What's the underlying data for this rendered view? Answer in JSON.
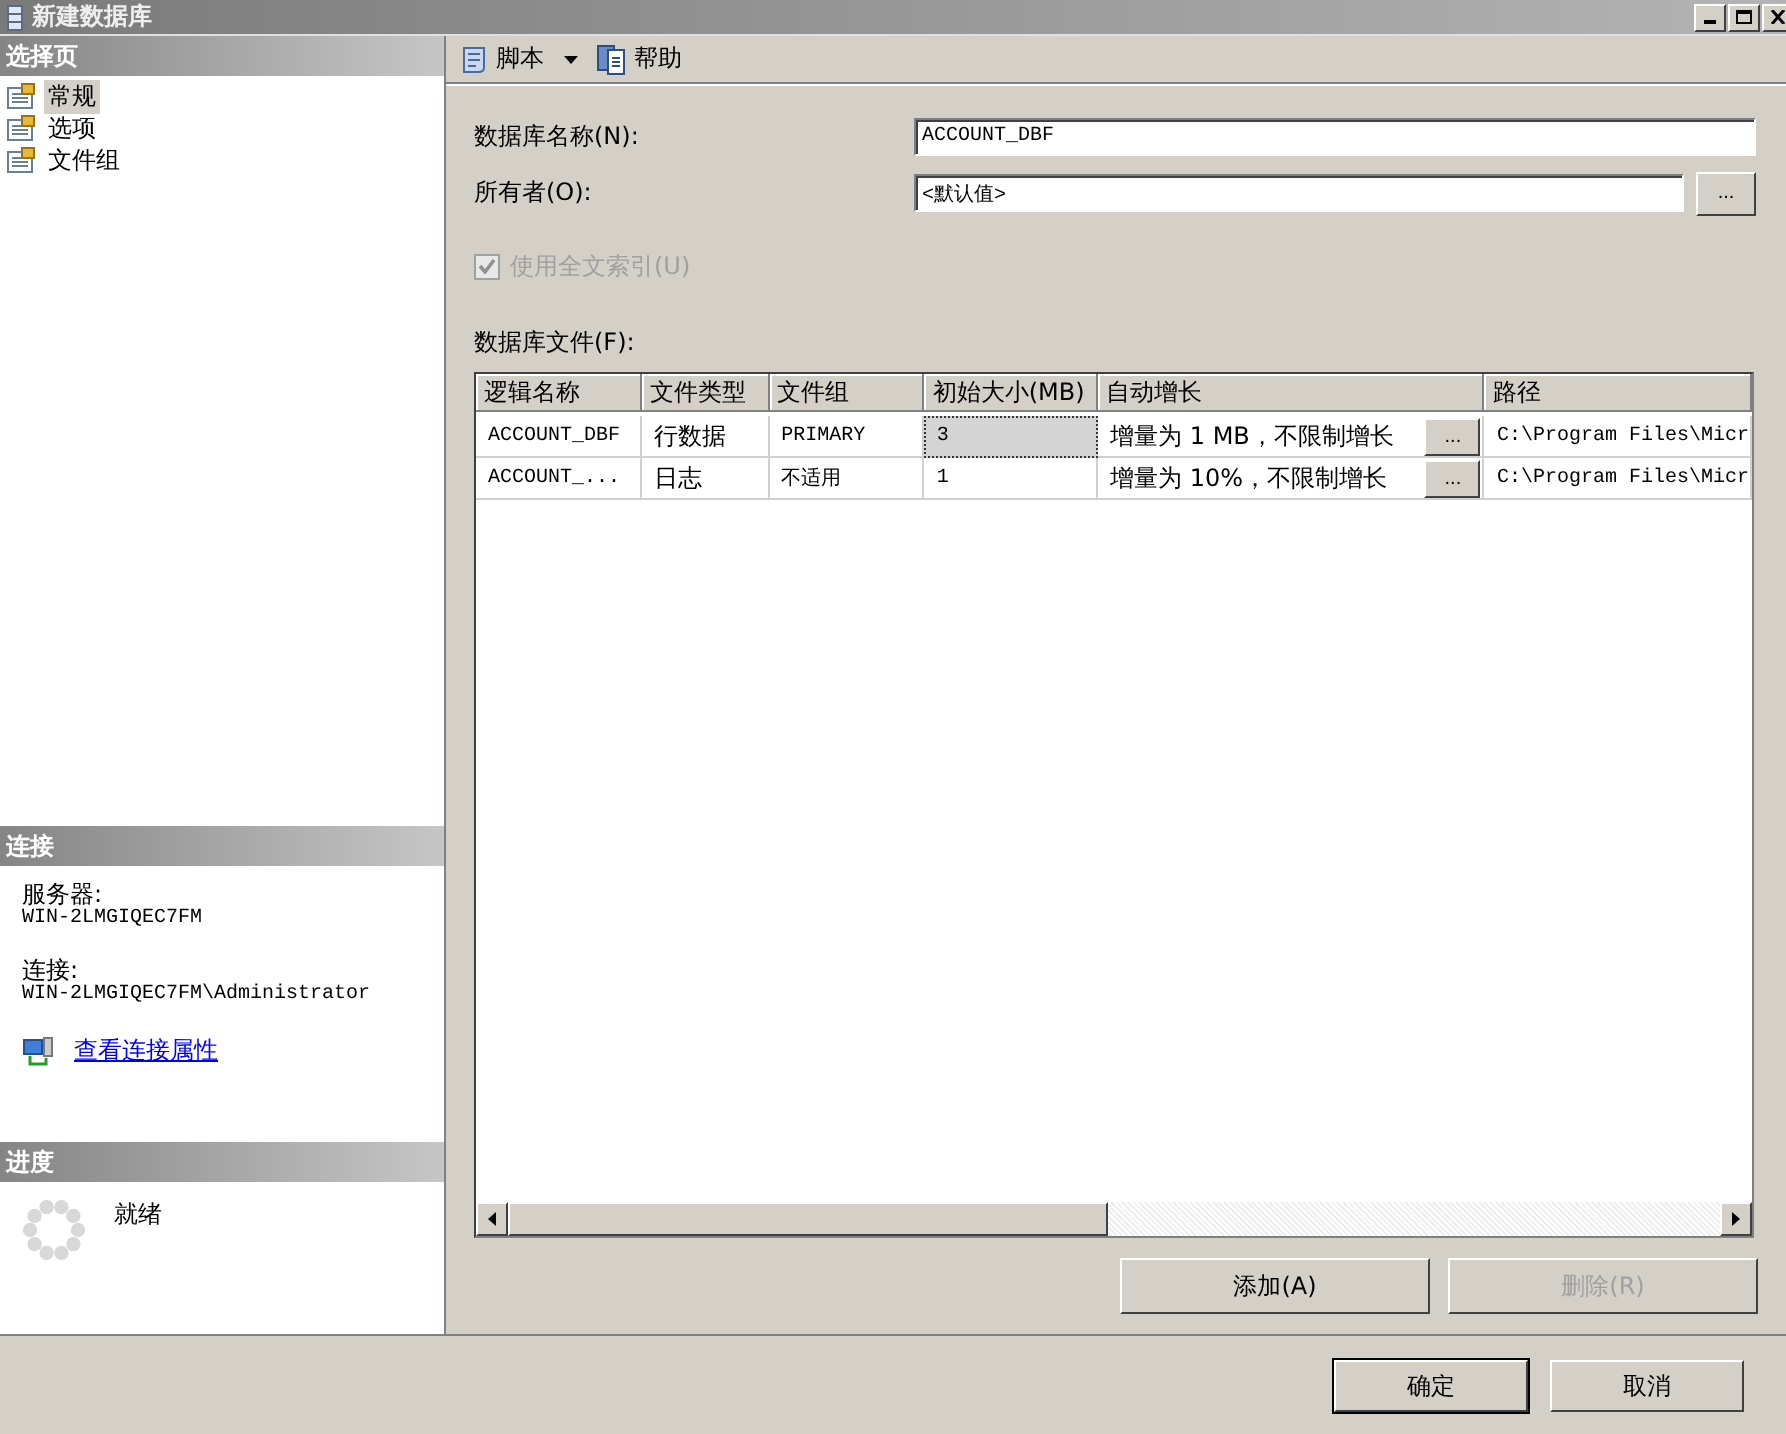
{
  "window": {
    "title": "新建数据库"
  },
  "sidebar": {
    "header": "选择页",
    "items": [
      {
        "label": "常规",
        "selected": true
      },
      {
        "label": "选项",
        "selected": false
      },
      {
        "label": "文件组",
        "selected": false
      }
    ]
  },
  "connection": {
    "header": "连接",
    "server_label": "服务器:",
    "server": "WIN-2LMGIQEC7FM",
    "connection_label": "连接:",
    "connection": "WIN-2LMGIQEC7FM\\Administrator",
    "link": "查看连接属性"
  },
  "progress": {
    "header": "进度",
    "status": "就绪"
  },
  "toolbar": [
    {
      "label": "脚本",
      "kind": "script",
      "dropdown": true
    },
    {
      "label": "帮助",
      "kind": "help",
      "dropdown": false
    }
  ],
  "form": {
    "name_label": "数据库名称(N):",
    "name_value": "ACCOUNT_DBF",
    "owner_label": "所有者(O):",
    "owner_value": "<默认值>",
    "owner_button": "...",
    "fulltext": {
      "label": "使用全文索引(U)",
      "checked": true,
      "disabled": true
    }
  },
  "files": {
    "label": "数据库文件(F):",
    "columns": [
      "逻辑名称",
      "文件类型",
      "文件组",
      "初始大小(MB)",
      "自动增长",
      "路径"
    ],
    "rows": [
      {
        "cells": [
          "ACCOUNT_DBF",
          "行数据",
          "PRIMARY",
          "3",
          "增量为 1 MB，不限制增长",
          "C:\\Program Files\\Micr"
        ],
        "growth_button": "...",
        "selected": true
      },
      {
        "cells": [
          "ACCOUNT_...",
          "日志",
          "不适用",
          "1",
          "增量为 10%，不限制增长",
          "C:\\Program Files\\Micr"
        ],
        "growth_button": "...",
        "selected": false
      }
    ]
  },
  "file_buttons": [
    {
      "label": "添加(A)",
      "disabled": false
    },
    {
      "label": "删除(R)",
      "disabled": true
    }
  ],
  "dialog_buttons": [
    {
      "label": "确定",
      "default": true
    },
    {
      "label": "取消",
      "default": false
    }
  ]
}
